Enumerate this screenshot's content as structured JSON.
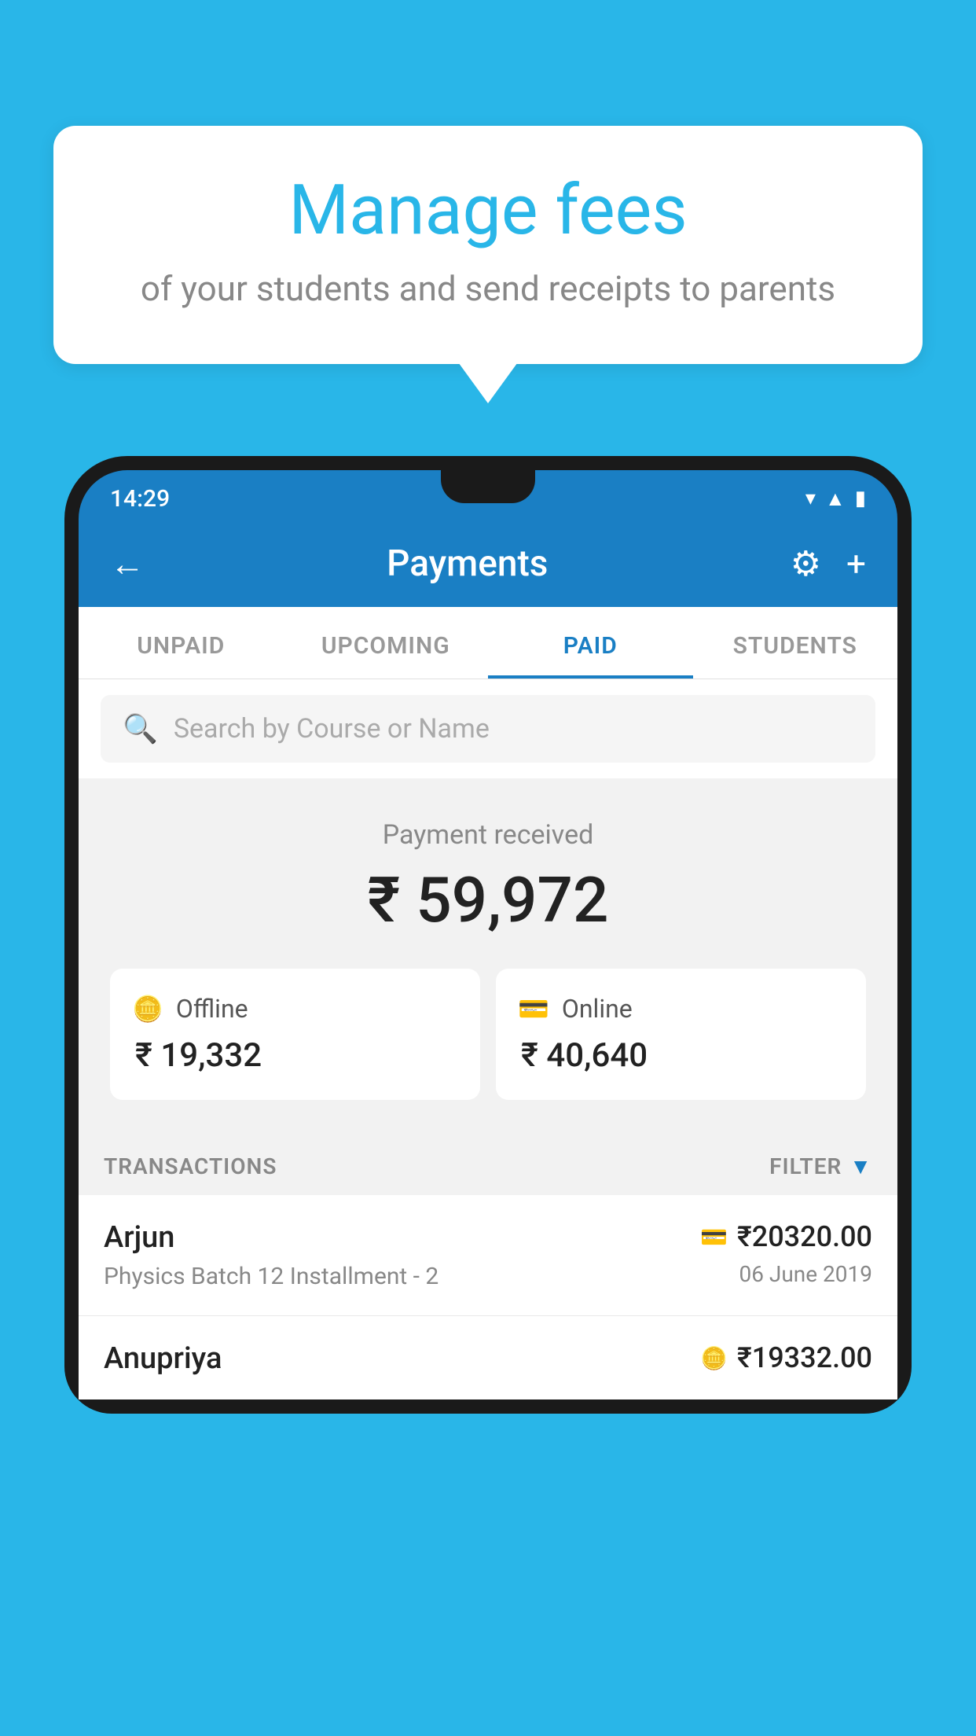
{
  "background_color": "#29b6e8",
  "bubble": {
    "title": "Manage fees",
    "subtitle": "of your students and send receipts to parents"
  },
  "phone": {
    "status_bar": {
      "time": "14:29",
      "icons": [
        "wifi",
        "signal",
        "battery"
      ]
    },
    "header": {
      "back_label": "←",
      "title": "Payments",
      "settings_icon": "⚙",
      "add_icon": "+"
    },
    "tabs": [
      {
        "label": "UNPAID",
        "active": false
      },
      {
        "label": "UPCOMING",
        "active": false
      },
      {
        "label": "PAID",
        "active": true
      },
      {
        "label": "STUDENTS",
        "active": false
      }
    ],
    "search": {
      "placeholder": "Search by Course or Name"
    },
    "payment_received": {
      "label": "Payment received",
      "amount": "₹ 59,972",
      "offline": {
        "type": "Offline",
        "amount": "₹ 19,332"
      },
      "online": {
        "type": "Online",
        "amount": "₹ 40,640"
      }
    },
    "transactions": {
      "header_label": "TRANSACTIONS",
      "filter_label": "FILTER",
      "rows": [
        {
          "name": "Arjun",
          "detail": "Physics Batch 12 Installment - 2",
          "amount": "₹20320.00",
          "date": "06 June 2019",
          "payment_type": "card"
        },
        {
          "name": "Anupriya",
          "detail": "",
          "amount": "₹19332.00",
          "date": "",
          "payment_type": "cash"
        }
      ]
    }
  }
}
